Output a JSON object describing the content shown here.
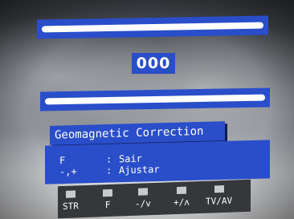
{
  "counter": {
    "value": "000"
  },
  "title": "Geomagnetic Correction",
  "info": [
    {
      "key": "F",
      "sep": ":",
      "action": "Sair"
    },
    {
      "key": "-,+",
      "sep": ":",
      "action": "Ajustar"
    }
  ],
  "buttons": [
    {
      "label": "STR"
    },
    {
      "label": "F"
    },
    {
      "label": "-/v"
    },
    {
      "label": "+/ʌ"
    },
    {
      "label": "TV/AV"
    }
  ],
  "colors": {
    "panel": "#2a4ec9",
    "text": "#ffffff",
    "button_bar": "#35373b"
  }
}
